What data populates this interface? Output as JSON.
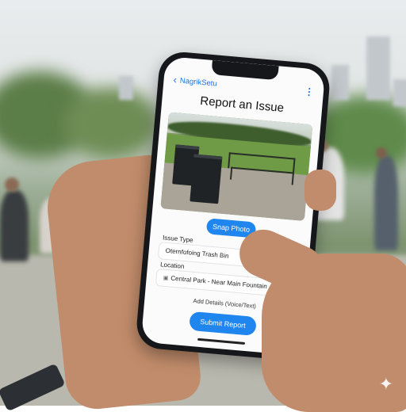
{
  "app": {
    "name": "NagrikSetu",
    "title": "Report an Issue"
  },
  "actions": {
    "snap_photo": "Snap Photo",
    "submit": "Submit Report",
    "add_details": "Add Details (Voice/Text)"
  },
  "fields": {
    "issue_type_label": "Issue Type",
    "issue_type_value": "Oternfofoing Trash Bin",
    "location_label": "Location",
    "location_value": "Central Park - Near Main Fountain"
  },
  "icons": {
    "back": "chevron-left-icon",
    "menu": "more-vert-icon",
    "location": "location-pin-icon",
    "sparkle": "sparkle-icon"
  },
  "colors": {
    "accent": "#1f86f0"
  }
}
